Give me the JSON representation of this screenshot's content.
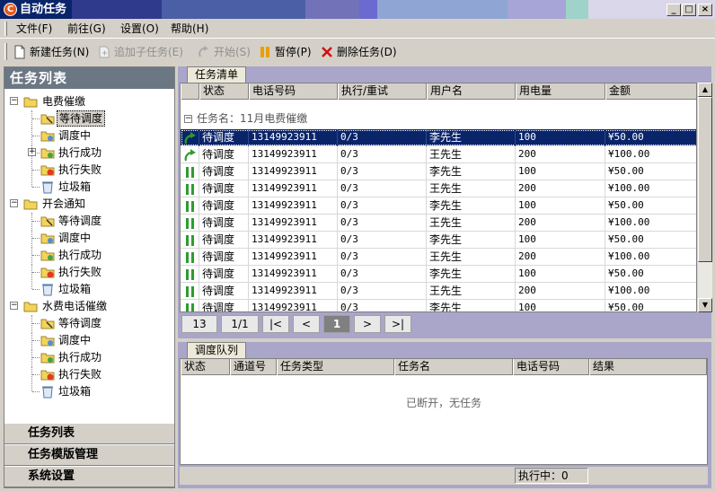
{
  "window": {
    "title": "自动任务",
    "icon": "app-logo-icon",
    "controls": [
      "minimize-icon",
      "maximize-icon",
      "close-icon"
    ]
  },
  "menu": [
    "文件(F)",
    "前往(G)",
    "设置(O)",
    "帮助(H)"
  ],
  "toolbar": {
    "new_task": "新建任务(N)",
    "add_subtask": "追加子任务(E)",
    "start": "开始(S)",
    "pause": "暂停(P)",
    "delete_task": "删除任务(D)"
  },
  "sidebar": {
    "header": "任务列表",
    "groups": [
      {
        "label": "电费催缴",
        "children": [
          "等待调度",
          "调度中",
          "执行成功",
          "执行失败",
          "垃圾箱"
        ]
      },
      {
        "label": "开会通知",
        "children": [
          "等待调度",
          "调度中",
          "执行成功",
          "执行失败",
          "垃圾箱"
        ]
      },
      {
        "label": "水费电话催缴",
        "children": [
          "等待调度",
          "调度中",
          "执行成功",
          "执行失败",
          "垃圾箱"
        ]
      }
    ],
    "nav": [
      "任务列表",
      "任务模版管理",
      "系统设置"
    ]
  },
  "task_list": {
    "tab": "任务清单",
    "columns": [
      "状态",
      "电话号码",
      "执行/重试",
      "用户名",
      "用电量",
      "金额"
    ],
    "group_label": "任务名：11月电费催缴",
    "rows": [
      {
        "icon": "retry-arrow-icon",
        "status": "待调度",
        "phone": "13149923911",
        "exec": "0/3",
        "user": "李先生",
        "usage": "100",
        "amount": "¥50.00"
      },
      {
        "icon": "retry-arrow-icon",
        "status": "待调度",
        "phone": "13149923911",
        "exec": "0/3",
        "user": "王先生",
        "usage": "200",
        "amount": "¥100.00"
      },
      {
        "icon": "pause-icon",
        "status": "待调度",
        "phone": "13149923911",
        "exec": "0/3",
        "user": "李先生",
        "usage": "100",
        "amount": "¥50.00"
      },
      {
        "icon": "pause-icon",
        "status": "待调度",
        "phone": "13149923911",
        "exec": "0/3",
        "user": "王先生",
        "usage": "200",
        "amount": "¥100.00"
      },
      {
        "icon": "pause-icon",
        "status": "待调度",
        "phone": "13149923911",
        "exec": "0/3",
        "user": "李先生",
        "usage": "100",
        "amount": "¥50.00"
      },
      {
        "icon": "pause-icon",
        "status": "待调度",
        "phone": "13149923911",
        "exec": "0/3",
        "user": "王先生",
        "usage": "200",
        "amount": "¥100.00"
      },
      {
        "icon": "pause-icon",
        "status": "待调度",
        "phone": "13149923911",
        "exec": "0/3",
        "user": "李先生",
        "usage": "100",
        "amount": "¥50.00"
      },
      {
        "icon": "pause-icon",
        "status": "待调度",
        "phone": "13149923911",
        "exec": "0/3",
        "user": "王先生",
        "usage": "200",
        "amount": "¥100.00"
      },
      {
        "icon": "pause-icon",
        "status": "待调度",
        "phone": "13149923911",
        "exec": "0/3",
        "user": "李先生",
        "usage": "100",
        "amount": "¥50.00"
      },
      {
        "icon": "pause-icon",
        "status": "待调度",
        "phone": "13149923911",
        "exec": "0/3",
        "user": "王先生",
        "usage": "200",
        "amount": "¥100.00"
      },
      {
        "icon": "pause-icon",
        "status": "待调度",
        "phone": "13149923911",
        "exec": "0/3",
        "user": "李先生",
        "usage": "100",
        "amount": "¥50.00"
      }
    ],
    "pager": {
      "total": "13",
      "page_info": "1/1",
      "first": "|<",
      "prev": "<",
      "current": "1",
      "next": ">",
      "last": ">|"
    }
  },
  "queue": {
    "tab": "调度队列",
    "columns": [
      "状态",
      "通道号",
      "任务类型",
      "任务名",
      "电话号码",
      "结果"
    ],
    "empty_text": "已断开，无任务",
    "status": "执行中：0"
  }
}
